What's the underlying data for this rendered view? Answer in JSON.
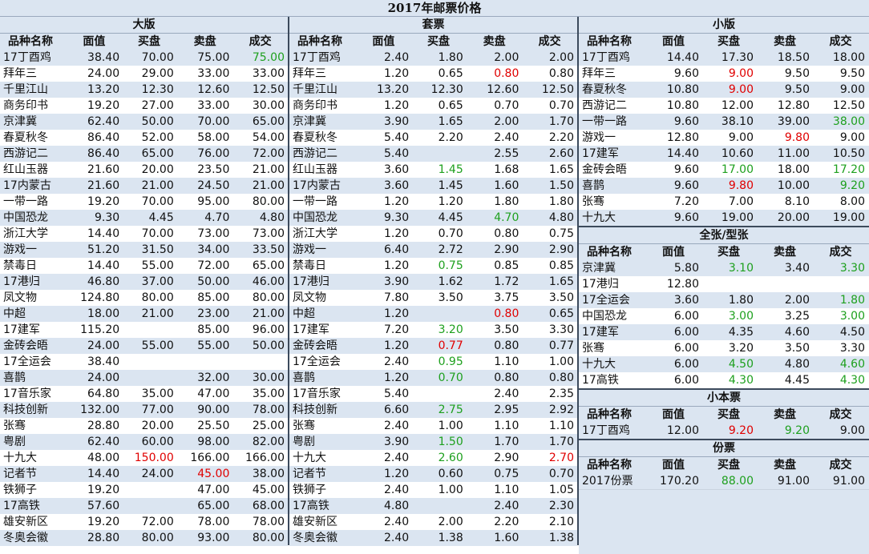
{
  "title": "2017年邮票价格",
  "columns": [
    "品种名称",
    "面值",
    "买盘",
    "卖盘",
    "成交"
  ],
  "colors": {
    "header_bg": "#dbe5f1",
    "up": "#1ea01e",
    "down": "#e00000"
  },
  "sections": {
    "daban": {
      "title": "大版",
      "rows": [
        [
          "17丁酉鸡",
          "38.40",
          "70.00",
          "75.00",
          "75.00"
        ],
        [
          "拜年三",
          "24.00",
          "29.00",
          "33.00",
          "33.00"
        ],
        [
          "千里江山",
          "13.20",
          "12.30",
          "12.60",
          "12.50"
        ],
        [
          "商务印书",
          "19.20",
          "27.00",
          "33.00",
          "30.00"
        ],
        [
          "京津冀",
          "62.40",
          "50.00",
          "70.00",
          "65.00"
        ],
        [
          "春夏秋冬",
          "86.40",
          "52.00",
          "58.00",
          "54.00"
        ],
        [
          "西游记二",
          "86.40",
          "65.00",
          "76.00",
          "72.00"
        ],
        [
          "红山玉器",
          "21.60",
          "20.00",
          "23.50",
          "21.00"
        ],
        [
          "17内蒙古",
          "21.60",
          "21.00",
          "24.50",
          "21.00"
        ],
        [
          "一带一路",
          "19.20",
          "70.00",
          "95.00",
          "80.00"
        ],
        [
          "中国恐龙",
          "9.30",
          "4.45",
          "4.70",
          "4.80"
        ],
        [
          "浙江大学",
          "14.40",
          "70.00",
          "73.00",
          "73.00"
        ],
        [
          "游戏一",
          "51.20",
          "31.50",
          "34.00",
          "33.50"
        ],
        [
          "禁毒日",
          "14.40",
          "55.00",
          "72.00",
          "65.00"
        ],
        [
          "17港归",
          "46.80",
          "37.00",
          "50.00",
          "46.00"
        ],
        [
          "凤文物",
          "124.80",
          "80.00",
          "85.00",
          "80.00"
        ],
        [
          "中超",
          "18.00",
          "21.00",
          "23.00",
          "21.00"
        ],
        [
          "17建军",
          "115.20",
          "",
          "85.00",
          "96.00"
        ],
        [
          "金砖会晤",
          "24.00",
          "55.00",
          "55.00",
          "50.00"
        ],
        [
          "17全运会",
          "38.40",
          "",
          "",
          ""
        ],
        [
          "喜鹊",
          "24.00",
          "",
          "32.00",
          "30.00"
        ],
        [
          "17音乐家",
          "64.80",
          "35.00",
          "47.00",
          "35.00"
        ],
        [
          "科技创新",
          "132.00",
          "77.00",
          "90.00",
          "78.00"
        ],
        [
          "张骞",
          "28.80",
          "20.00",
          "25.50",
          "25.00"
        ],
        [
          "粤剧",
          "62.40",
          "60.00",
          "98.00",
          "82.00"
        ],
        [
          "十九大",
          "48.00",
          "150.00",
          "166.00",
          "166.00"
        ],
        [
          "记者节",
          "14.40",
          "24.00",
          "45.00",
          "38.00"
        ],
        [
          "铁狮子",
          "19.20",
          "",
          "47.00",
          "45.00"
        ],
        [
          "17高铁",
          "57.60",
          "",
          "65.00",
          "68.00"
        ],
        [
          "雄安新区",
          "19.20",
          "72.00",
          "78.00",
          "78.00"
        ],
        [
          "冬奥会徽",
          "28.80",
          "80.00",
          "93.00",
          "80.00"
        ]
      ],
      "colored": {
        "0-4": "green",
        "25-2": "red",
        "26-3": "red"
      }
    },
    "taopiao": {
      "title": "套票",
      "rows": [
        [
          "17丁酉鸡",
          "2.40",
          "1.80",
          "2.00",
          "2.00"
        ],
        [
          "拜年三",
          "1.20",
          "0.65",
          "0.80",
          "0.80"
        ],
        [
          "千里江山",
          "13.20",
          "12.30",
          "12.60",
          "12.50"
        ],
        [
          "商务印书",
          "1.20",
          "0.65",
          "0.70",
          "0.70"
        ],
        [
          "京津冀",
          "3.90",
          "1.65",
          "2.00",
          "1.70"
        ],
        [
          "春夏秋冬",
          "5.40",
          "2.20",
          "2.40",
          "2.20"
        ],
        [
          "西游记二",
          "5.40",
          "",
          "2.55",
          "2.60"
        ],
        [
          "红山玉器",
          "3.60",
          "1.45",
          "1.68",
          "1.65"
        ],
        [
          "17内蒙古",
          "3.60",
          "1.45",
          "1.60",
          "1.50"
        ],
        [
          "一带一路",
          "1.20",
          "1.20",
          "1.80",
          "1.80"
        ],
        [
          "中国恐龙",
          "9.30",
          "4.45",
          "4.70",
          "4.80"
        ],
        [
          "浙江大学",
          "1.20",
          "0.70",
          "0.80",
          "0.75"
        ],
        [
          "游戏一",
          "6.40",
          "2.72",
          "2.90",
          "2.90"
        ],
        [
          "禁毒日",
          "1.20",
          "0.75",
          "0.85",
          "0.85"
        ],
        [
          "17港归",
          "3.90",
          "1.62",
          "1.72",
          "1.65"
        ],
        [
          "凤文物",
          "7.80",
          "3.50",
          "3.75",
          "3.50"
        ],
        [
          "中超",
          "1.20",
          "",
          "0.80",
          "0.65"
        ],
        [
          "17建军",
          "7.20",
          "3.20",
          "3.50",
          "3.30"
        ],
        [
          "金砖会晤",
          "1.20",
          "0.77",
          "0.80",
          "0.77"
        ],
        [
          "17全运会",
          "2.40",
          "0.95",
          "1.10",
          "1.00"
        ],
        [
          "喜鹊",
          "1.20",
          "0.70",
          "0.80",
          "0.80"
        ],
        [
          "17音乐家",
          "5.40",
          "",
          "2.40",
          "2.35"
        ],
        [
          "科技创新",
          "6.60",
          "2.75",
          "2.95",
          "2.92"
        ],
        [
          "张骞",
          "2.40",
          "1.00",
          "1.10",
          "1.10"
        ],
        [
          "粤剧",
          "3.90",
          "1.50",
          "1.70",
          "1.70"
        ],
        [
          "十九大",
          "2.40",
          "2.60",
          "2.90",
          "2.70"
        ],
        [
          "记者节",
          "1.20",
          "0.60",
          "0.75",
          "0.70"
        ],
        [
          "铁狮子",
          "2.40",
          "1.00",
          "1.10",
          "1.05"
        ],
        [
          "17高铁",
          "4.80",
          "",
          "2.40",
          "2.30"
        ],
        [
          "雄安新区",
          "2.40",
          "2.00",
          "2.20",
          "2.10"
        ],
        [
          "冬奥会徽",
          "2.40",
          "1.38",
          "1.60",
          "1.38"
        ]
      ],
      "colored": {
        "1-3": "red",
        "7-2": "green",
        "10-3": "green",
        "13-2": "green",
        "16-3": "red",
        "17-2": "green",
        "18-2": "red",
        "19-2": "green",
        "20-2": "green",
        "22-2": "green",
        "24-2": "green",
        "25-2": "green",
        "25-4": "red"
      }
    },
    "xiaoban": {
      "title": "小版",
      "rows": [
        [
          "17丁酉鸡",
          "14.40",
          "17.30",
          "18.50",
          "18.00"
        ],
        [
          "拜年三",
          "9.60",
          "9.00",
          "9.50",
          "9.50"
        ],
        [
          "春夏秋冬",
          "10.80",
          "9.00",
          "9.50",
          "9.00"
        ],
        [
          "西游记二",
          "10.80",
          "12.00",
          "12.80",
          "12.50"
        ],
        [
          "一带一路",
          "9.60",
          "38.10",
          "39.00",
          "38.00"
        ],
        [
          "游戏一",
          "12.80",
          "9.00",
          "9.80",
          "9.00"
        ],
        [
          "17建军",
          "14.40",
          "10.60",
          "11.00",
          "10.50"
        ],
        [
          "金砖会晤",
          "9.60",
          "17.00",
          "18.00",
          "17.20"
        ],
        [
          "喜鹊",
          "9.60",
          "9.80",
          "10.00",
          "9.20"
        ],
        [
          "张骞",
          "7.20",
          "7.00",
          "8.10",
          "8.00"
        ],
        [
          "十九大",
          "9.60",
          "19.00",
          "20.00",
          "19.00"
        ]
      ],
      "colored": {
        "1-2": "red",
        "2-2": "red",
        "4-4": "green",
        "5-3": "red",
        "7-2": "green",
        "7-4": "green",
        "8-2": "red",
        "8-4": "green"
      }
    },
    "quanzhang": {
      "title": "全张/型张",
      "rows": [
        [
          "京津冀",
          "5.80",
          "3.10",
          "3.40",
          "3.30"
        ],
        [
          "17港归",
          "12.80",
          "",
          "",
          ""
        ],
        [
          "17全运会",
          "3.60",
          "1.80",
          "2.00",
          "1.80"
        ],
        [
          "中国恐龙",
          "6.00",
          "3.00",
          "3.25",
          "3.00"
        ],
        [
          "17建军",
          "6.00",
          "4.35",
          "4.60",
          "4.50"
        ],
        [
          "张骞",
          "6.00",
          "3.20",
          "3.50",
          "3.30"
        ],
        [
          "十九大",
          "6.00",
          "4.50",
          "4.80",
          "4.60"
        ],
        [
          "17高铁",
          "6.00",
          "4.30",
          "4.45",
          "4.30"
        ]
      ],
      "colored": {
        "0-2": "green",
        "0-4": "green",
        "2-4": "green",
        "3-2": "green",
        "3-4": "green",
        "6-2": "green",
        "6-4": "green",
        "7-2": "green",
        "7-4": "green"
      }
    },
    "xiaobenpiao": {
      "title": "小本票",
      "rows": [
        [
          "17丁酉鸡",
          "12.00",
          "9.20",
          "9.20",
          "9.00"
        ]
      ],
      "colored": {
        "0-2": "red",
        "0-3": "green"
      }
    },
    "fenpiao": {
      "title": "份票",
      "rows": [
        [
          "2017份票",
          "170.20",
          "88.00",
          "91.00",
          "91.00"
        ]
      ],
      "colored": {
        "0-2": "green"
      }
    }
  }
}
